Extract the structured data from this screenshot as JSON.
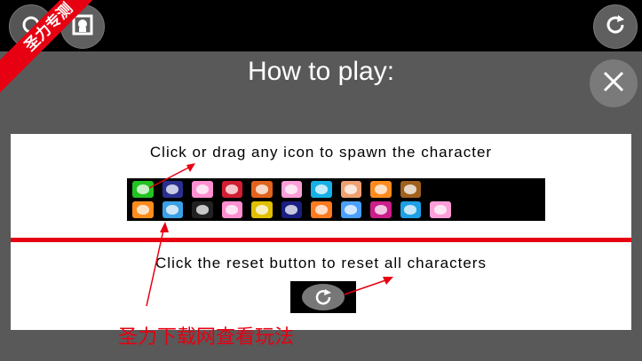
{
  "ribbon": {
    "text": "圣力专测"
  },
  "toolbar": {
    "left_icons": [
      "circle-button-icon",
      "image-frame-icon"
    ],
    "reset_icon": "refresh-icon"
  },
  "dialog": {
    "title": "How to play:",
    "close_icon": "close-icon",
    "instruction_spawn": "Click or drag any icon to spawn the character",
    "instruction_reset": "Click the reset button to reset all characters"
  },
  "icon_grid": {
    "row1": [
      "#22c322",
      "#2a2f8f",
      "#ff8fd0",
      "#d21e32",
      "#e0641e",
      "#ff9ed8",
      "#17b0e6",
      "#f0a070",
      "#ff8c1e",
      "#a0601e",
      "",
      "",
      "",
      ""
    ],
    "row2": [
      "#ff8c1e",
      "#3aa0e6",
      "#222222",
      "#ff8fd0",
      "#e0c000",
      "#1a2080",
      "#ff7a20",
      "#4aa0ff",
      "#cc1e8a",
      "#1ea0e6",
      "#ff9ed8",
      "",
      "",
      ""
    ]
  },
  "watermark": {
    "text": "圣力下载网查看玩法"
  },
  "colors": {
    "accent": "#e60012",
    "dialog_bg": "#595959",
    "button_bg": "#5f5f5f"
  }
}
